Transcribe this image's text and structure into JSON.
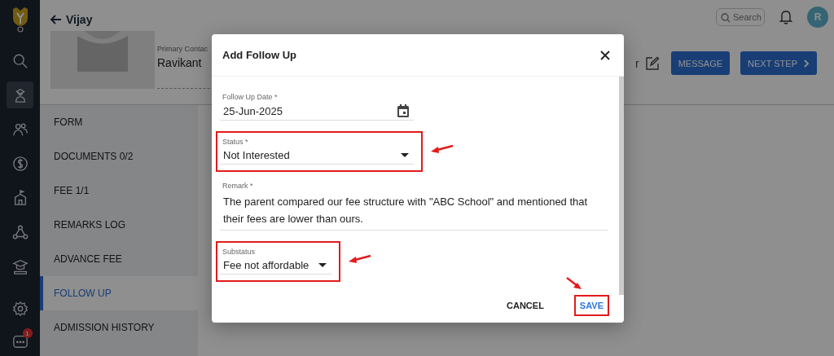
{
  "rail": {
    "items": [
      {
        "kind": "search",
        "selected": false
      },
      {
        "kind": "student",
        "selected": true
      },
      {
        "kind": "people",
        "selected": false
      },
      {
        "kind": "money",
        "selected": false
      },
      {
        "kind": "school",
        "selected": false
      },
      {
        "kind": "network",
        "selected": false
      },
      {
        "kind": "graduation",
        "selected": false
      }
    ],
    "bottom_items": [
      {
        "kind": "settings"
      },
      {
        "kind": "chat",
        "badge": "1"
      }
    ]
  },
  "header": {
    "back_label": "Vijay"
  },
  "topbar": {
    "search": {
      "placeholder": "Search"
    },
    "avatar": "R"
  },
  "profile": {
    "contact_label": "Primary Contac",
    "contact_value": "Ravikant",
    "column_3_value": "r"
  },
  "actions": [
    {
      "label": "MESSAGE",
      "chevron": false
    },
    {
      "label": "NEXT STEP",
      "chevron": true
    }
  ],
  "tabs": [
    {
      "label": "FORM",
      "selected": false
    },
    {
      "label": "DOCUMENTS 0/2",
      "selected": false
    },
    {
      "label": "FEE 1/1",
      "selected": false
    },
    {
      "label": "REMARKS LOG",
      "selected": false
    },
    {
      "label": "ADVANCE FEE",
      "selected": false
    },
    {
      "label": "FOLLOW UP",
      "selected": true
    },
    {
      "label": "ADMISSION HISTORY",
      "selected": false
    }
  ],
  "dialog": {
    "title": "Add Follow Up",
    "fields": [
      {
        "kind": "date",
        "label": "Follow Up Date *",
        "value": "25-Jun-2025",
        "highlighted": false
      },
      {
        "kind": "select",
        "label": "Status *",
        "value": "Not Interested",
        "highlighted": true
      },
      {
        "kind": "textarea",
        "label": "Remark *",
        "value": "The parent compared our fee structure with \"ABC School\" and mentioned that their fees are lower than ours.",
        "highlighted": false
      },
      {
        "kind": "select",
        "label": "Substatus",
        "value": "Fee not affordable",
        "highlighted": true
      }
    ],
    "buttons": [
      {
        "label": "CANCEL",
        "kind": "text",
        "highlighted": false
      },
      {
        "label": "SAVE",
        "kind": "primary",
        "highlighted": true
      }
    ]
  }
}
